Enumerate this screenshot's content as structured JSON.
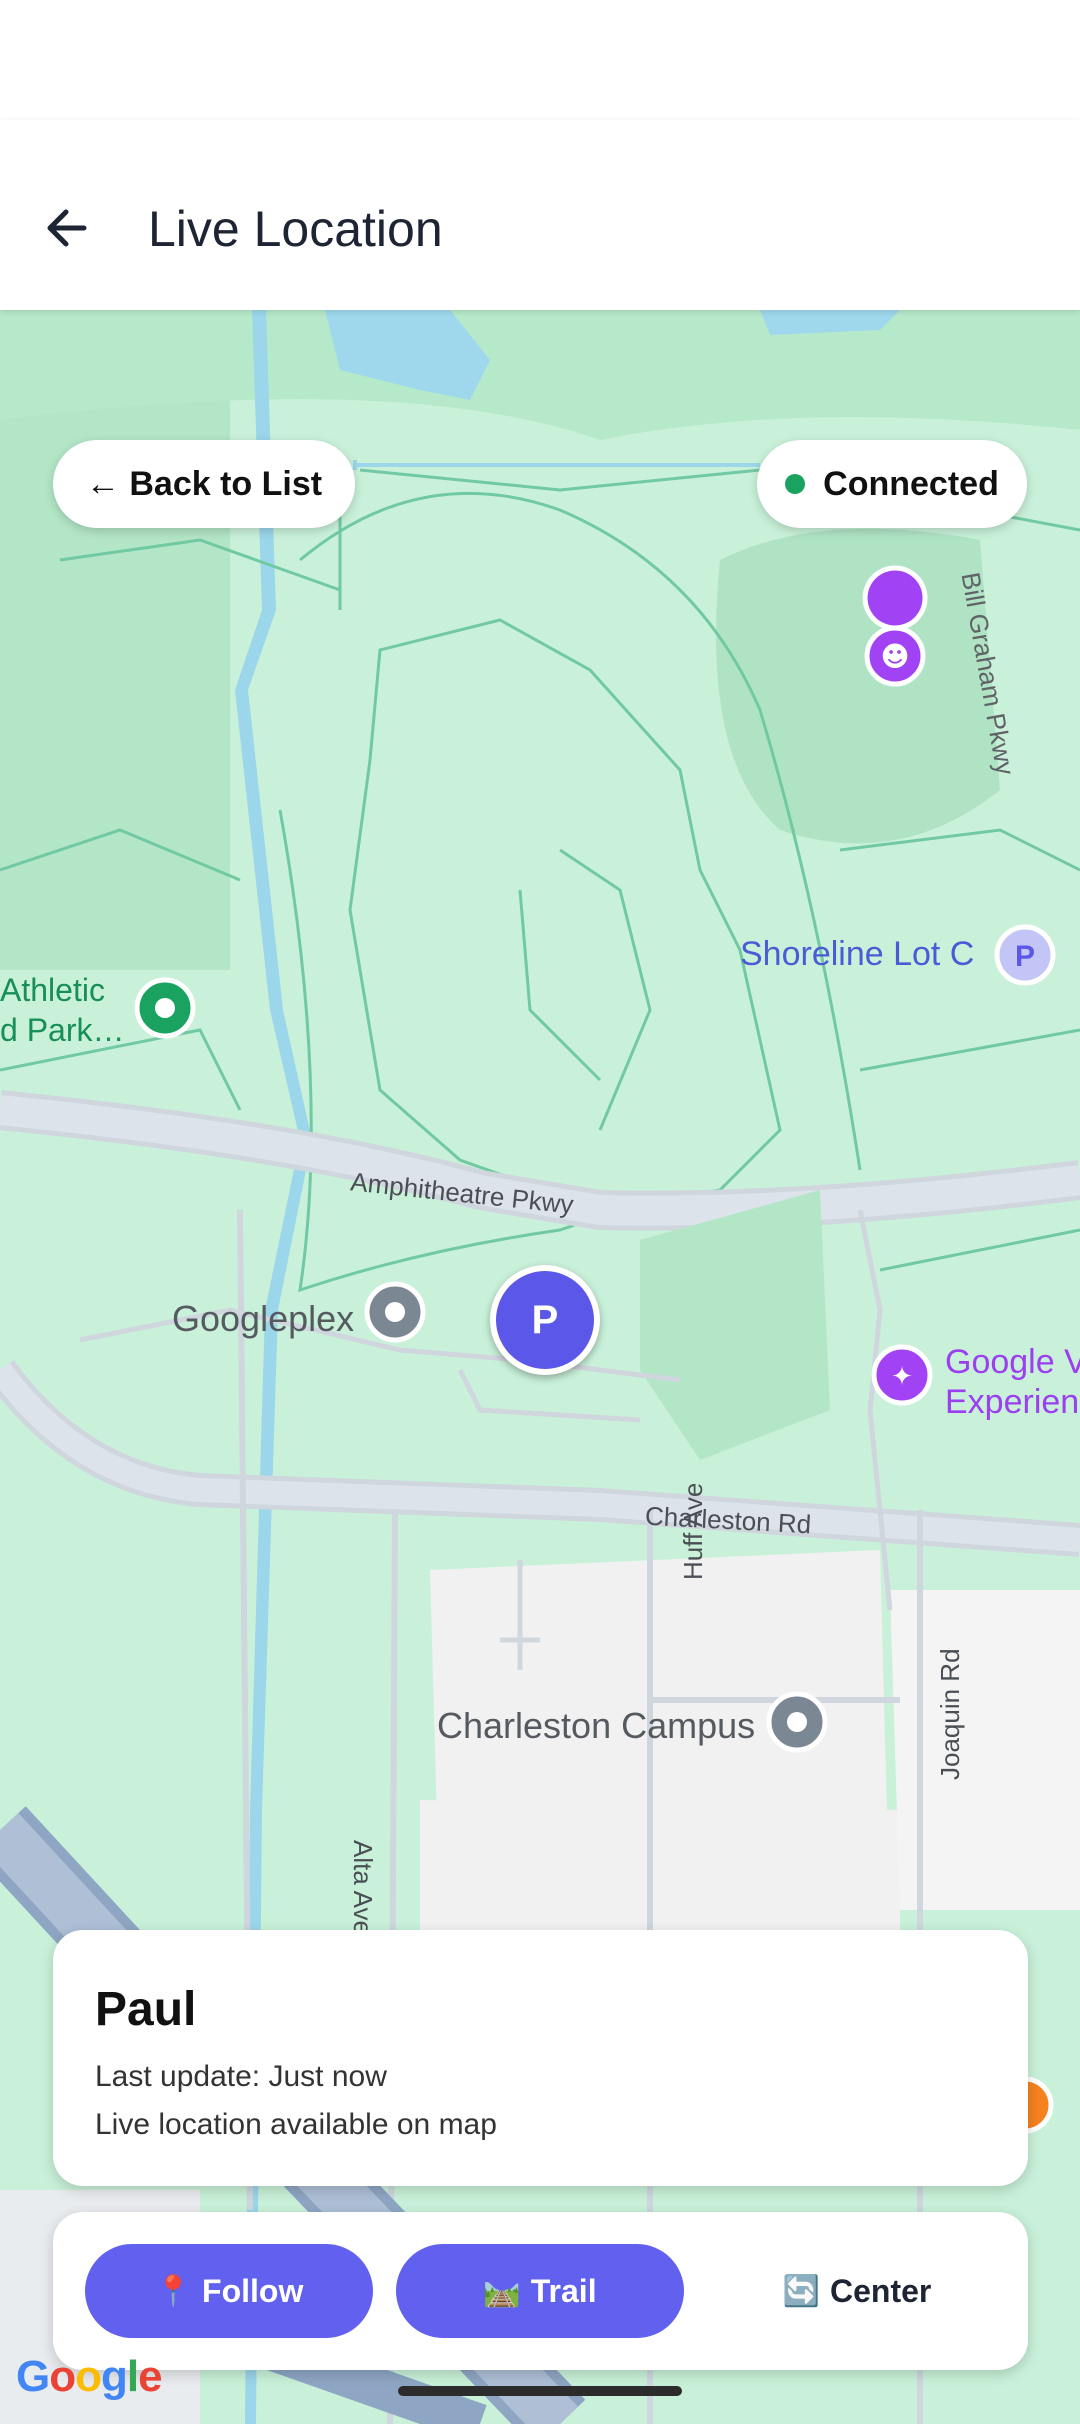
{
  "header": {
    "title": "Live Location",
    "back_icon": "arrow-left-icon"
  },
  "map": {
    "labels": {
      "back_to_list": "← Back to List",
      "connected": "Connected",
      "connected_color": "#1aa260",
      "graham_pkwy": "Bill Graham Pkwy",
      "shoreline": "Shoreline Lot C",
      "athletic_1": "Athletic",
      "athletic_2": "d Park…",
      "amphitheatre": "Amphitheatre Pkwy",
      "googleplex": "Googleplex",
      "google_visitor_1": "Google V",
      "google_visitor_2": "Experien",
      "charleston_rd": "Charleston Rd",
      "huff_ave": "Huff Ave",
      "joaquin_rd": "Joaquin Rd",
      "charleston_campus": "Charleston Campus",
      "alta_ave": "Alta Ave",
      "person_marker": "P",
      "parking_marker": "P"
    },
    "colors": {
      "accent": "#5b57e8",
      "poi_purple": "#a142f4",
      "poi_green": "#1aa260",
      "poi_gray": "#7c8794"
    }
  },
  "info": {
    "name": "Paul",
    "last_update": "Last update: Just now",
    "status": "Live location available on map"
  },
  "controls": {
    "follow_icon": "📍",
    "follow": "Follow",
    "trail_icon": "🛤️",
    "trail": "Trail",
    "center_icon": "🔄",
    "center": "Center"
  },
  "brand": {
    "google": "Google"
  }
}
